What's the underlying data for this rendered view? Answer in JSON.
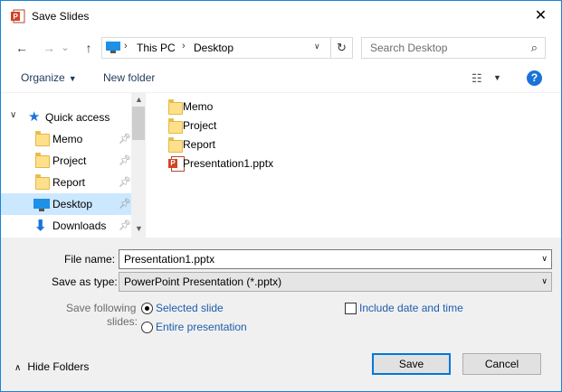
{
  "window": {
    "title": "Save Slides",
    "close_glyph": "✕"
  },
  "nav": {
    "back": "←",
    "forward": "→",
    "down": "⌄",
    "up": "↑",
    "breadcrumb": [
      "This PC",
      "Desktop"
    ],
    "refresh": "↻",
    "search_placeholder": "Search Desktop",
    "search_icon": "⌕"
  },
  "toolbar": {
    "organize": "Organize",
    "new_folder": "New folder",
    "help": "?"
  },
  "navpane": {
    "quick_access": "Quick access",
    "items": [
      {
        "label": "Memo",
        "icon": "folder-icon",
        "pinned": true
      },
      {
        "label": "Project",
        "icon": "folder-icon",
        "pinned": true
      },
      {
        "label": "Report",
        "icon": "folder-icon",
        "pinned": true
      },
      {
        "label": "Desktop",
        "icon": "desktop-icon",
        "pinned": true,
        "selected": true
      },
      {
        "label": "Downloads",
        "icon": "download-icon",
        "pinned": true
      }
    ]
  },
  "files": [
    {
      "label": "Memo",
      "type": "folder"
    },
    {
      "label": "Project",
      "type": "folder"
    },
    {
      "label": "Report",
      "type": "folder"
    },
    {
      "label": "Presentation1.pptx",
      "type": "pptx"
    }
  ],
  "form": {
    "file_name_label": "File name:",
    "file_name_value": "Presentation1.pptx",
    "save_type_label": "Save as type:",
    "save_type_value": "PowerPoint Presentation (*.pptx)",
    "save_following_label_1": "Save following",
    "save_following_label_2": "slides:",
    "opt_selected": "Selected slide",
    "opt_entire": "Entire presentation",
    "include_date": "Include date and time"
  },
  "footer": {
    "hide_folders": "Hide Folders",
    "save": "Save",
    "cancel": "Cancel"
  },
  "colors": {
    "accent": "#0078d7",
    "link": "#1c5dad",
    "selection": "#cce8ff"
  }
}
